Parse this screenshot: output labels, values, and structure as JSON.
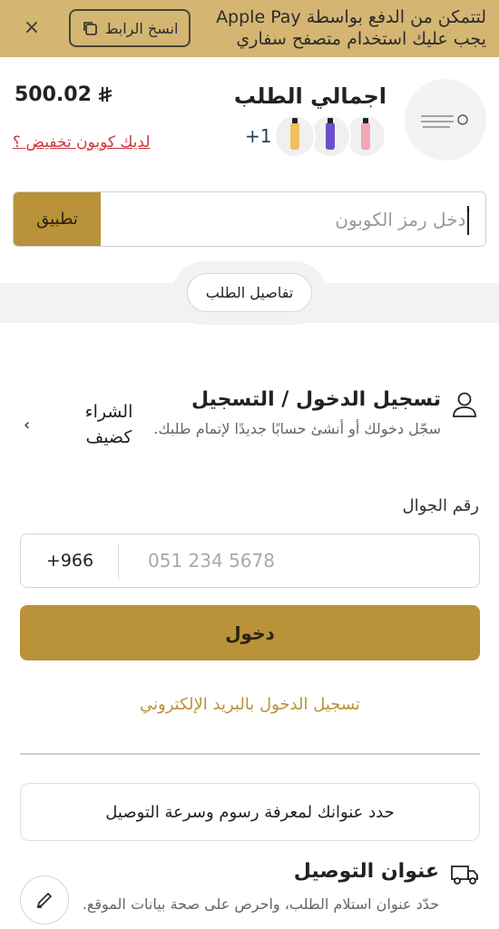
{
  "banner": {
    "message": "لتتمكن من الدفع بواسطة Apple Pay يجب عليك استخدام متصفح سفاري",
    "copy_label": "انسخ الرابط",
    "close_symbol": "×"
  },
  "order": {
    "title": "اجمالي الطلب",
    "total": "500.02",
    "currency_symbol": "⃁",
    "coupon_prompt": "لديك كوبون تخفيض ؟",
    "more_items": "+1",
    "products": [
      {
        "color": "#f0c060"
      },
      {
        "color": "#6b4fc8"
      },
      {
        "color": "#f3a6b8"
      }
    ]
  },
  "coupon": {
    "placeholder": "أدخل رمز الكوبون",
    "apply_label": "تطبيق"
  },
  "details_pill": "تفاصيل الطلب",
  "login": {
    "title": "تسجيل الدخول / التسجيل",
    "description": "سجّل دخولك أو أنشئ حسابًا جديدًا لإتمام طلبك.",
    "guest_label": "الشراء كضيف",
    "phone_label": "رقم الجوال",
    "country_code": "+966",
    "phone_placeholder": "051 234 5678",
    "submit_label": "دخول",
    "email_login": "تسجيل الدخول بالبريد الإلكتروني"
  },
  "address_prompt": "حدد عنوانك لمعرفة رسوم وسرعة التوصيل",
  "delivery": {
    "title": "عنوان التوصيل",
    "description": "حدّد عنوان استلام الطلب، واحرص على صحة بيانات الموقع."
  },
  "colors": {
    "accent": "#b99239",
    "banner": "#d4b572",
    "link_red": "#d0363d"
  }
}
